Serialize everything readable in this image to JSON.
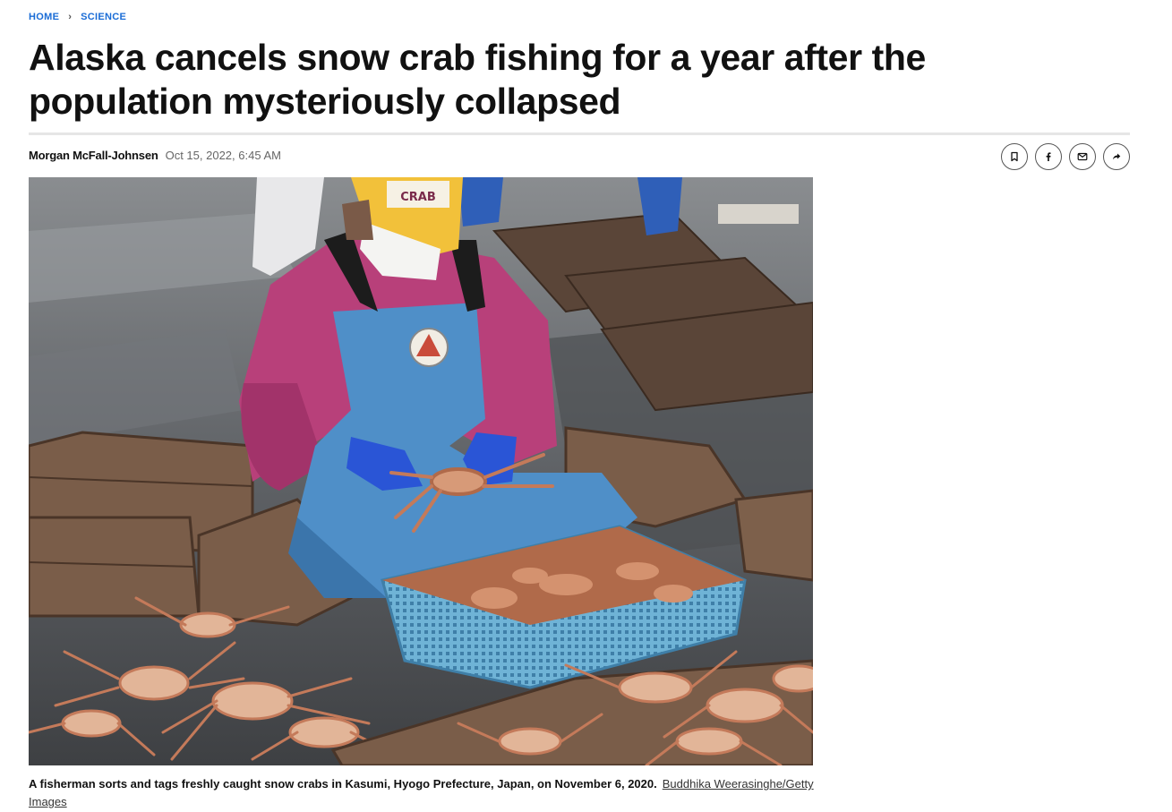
{
  "breadcrumb": {
    "home": "HOME",
    "separator": "›",
    "section": "SCIENCE"
  },
  "article": {
    "headline": "Alaska cancels snow crab fishing for a year after the population mysteriously collapsed",
    "author": "Morgan McFall-Johnsen",
    "date": "Oct 15, 2022, 6:45 AM"
  },
  "share_icons": [
    "bookmark-icon",
    "facebook-icon",
    "email-icon",
    "share-icon"
  ],
  "image": {
    "caption": "A fisherman sorts and tags freshly caught snow crabs in Kasumi, Hyogo Prefecture, Japan, on November 6, 2020.",
    "credit": "Buddhika Weerasinghe/Getty Images",
    "cap_text": "CRAB"
  },
  "colors": {
    "link": "#1a6cd6",
    "jacket": "#b8407a",
    "apron": "#4f8fc8",
    "basket": "#6fb3d6",
    "cap": "#f2c13a",
    "crab": "#c47a5a",
    "crate": "#7a5d49"
  }
}
